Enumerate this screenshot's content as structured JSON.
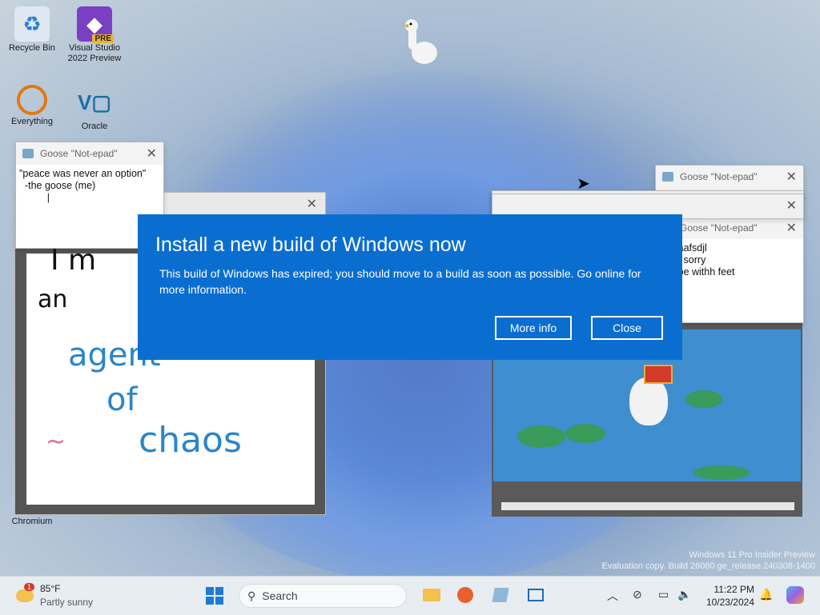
{
  "desktop": {
    "icons": [
      {
        "name": "recycle-bin",
        "label": "Recycle Bin"
      },
      {
        "name": "visual-studio",
        "label": "Visual Studio 2022 Preview",
        "badge": "PRE"
      },
      {
        "name": "everything",
        "label": "Everything"
      },
      {
        "name": "oracle",
        "label": "Oracle"
      },
      {
        "name": "chromium",
        "label": "Chromium"
      }
    ]
  },
  "notepads": [
    {
      "title": "Goose \"Not-epad\"",
      "text": "\"peace was never an option\"\n  -the goose (me)\n          |"
    },
    {
      "title": "Goose \"Not-epad\"",
      "text": ""
    },
    {
      "title": "Goose \"Not-epad\"",
      "text": "afdsaafsdjl\ns       sorry\nto type withh feet\n      |"
    }
  ],
  "paint": {
    "words": [
      "I m",
      "an",
      "agent",
      "of",
      "chaos",
      "~"
    ]
  },
  "dialog": {
    "title": "Install a new build of Windows now",
    "message": "This build of Windows has expired; you should move to a build as soon as possible. Go online for more information.",
    "more_info": "More info",
    "close": "Close"
  },
  "watermark": {
    "line1": "Windows 11 Pro Insider Preview",
    "line2": "Evaluation copy. Build 26080.ge_release.240308-1400"
  },
  "taskbar": {
    "weather_temp": "85°F",
    "weather_desc": "Partly sunny",
    "search_placeholder": "Search",
    "time": "11:22 PM",
    "date": "10/23/2024",
    "weather_badge": "1"
  },
  "colors": {
    "dialog_bg": "#0a6ed1",
    "accent": "#0a6ed1"
  }
}
